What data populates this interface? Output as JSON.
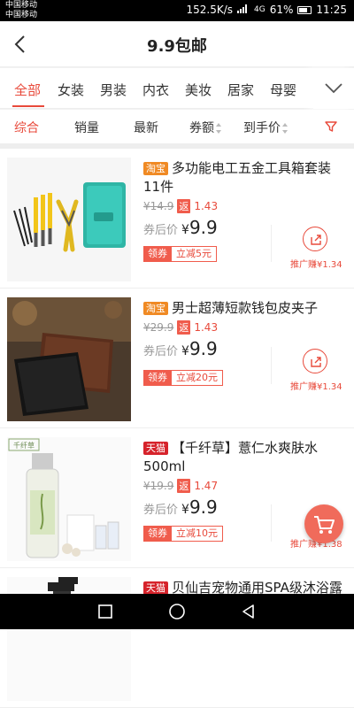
{
  "status": {
    "carrier1": "中国移动",
    "carrier2": "中国移动",
    "speed": "152.5K/s",
    "network": "4G",
    "battery": "61%",
    "time": "11:25"
  },
  "header": {
    "title": "9.9包邮"
  },
  "categories": [
    {
      "label": "全部",
      "active": true
    },
    {
      "label": "女装"
    },
    {
      "label": "男装"
    },
    {
      "label": "内衣"
    },
    {
      "label": "美妆"
    },
    {
      "label": "居家"
    },
    {
      "label": "母婴"
    }
  ],
  "sort": {
    "comprehensive": "综合",
    "sales": "销量",
    "newest": "最新",
    "coupon": "券额",
    "final_price": "到手价"
  },
  "products": [
    {
      "source": "淘宝",
      "title": "多功能电工五金工具箱套装11件",
      "original_price": "¥14.9",
      "rebate_tag": "返",
      "rebate": "1.43",
      "after_label": "券后价",
      "yen": "¥",
      "price": "9.9",
      "coupon_tag": "领券",
      "coupon_text": "立减5元",
      "share_label": "推广赚¥1.34"
    },
    {
      "source": "淘宝",
      "title": "男士超薄短款钱包皮夹子",
      "original_price": "¥29.9",
      "rebate_tag": "返",
      "rebate": "1.43",
      "after_label": "券后价",
      "yen": "¥",
      "price": "9.9",
      "coupon_tag": "领券",
      "coupon_text": "立减20元",
      "share_label": "推广赚¥1.34"
    },
    {
      "source": "天猫",
      "title": "【千纤草】薏仁水爽肤水500ml",
      "original_price": "¥19.9",
      "rebate_tag": "返",
      "rebate": "1.47",
      "after_label": "券后价",
      "yen": "¥",
      "price": "9.9",
      "coupon_tag": "领券",
      "coupon_text": "立减10元",
      "share_label": "推广赚¥1.38"
    },
    {
      "source": "天猫",
      "title": "贝仙吉宠物通用SPA级沐浴露"
    }
  ],
  "images": {
    "bottle_brand": "千纤草"
  },
  "colors": {
    "accent": "#e84a3b",
    "taobao": "#f08a24",
    "tmall": "#d6232b"
  },
  "icons": {
    "back": "chevron-left-icon",
    "more": "chevron-down-icon",
    "filter": "funnel-icon",
    "share": "share-icon",
    "cart": "cart-icon"
  }
}
